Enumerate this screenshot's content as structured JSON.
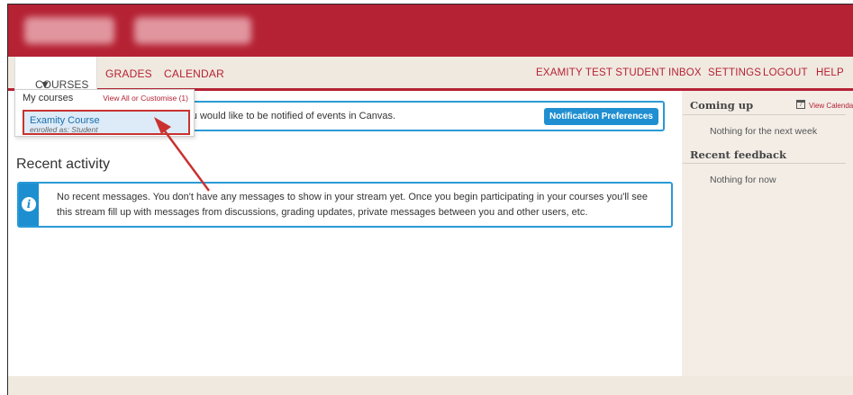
{
  "nav": {
    "courses": "COURSES",
    "grades": "GRADES",
    "calendar": "CALENDAR",
    "user": "EXAMITY TEST STUDENT",
    "inbox": "INBOX",
    "settings": "SETTINGS",
    "logout": "LOGOUT",
    "help": "HELP"
  },
  "dropdown": {
    "my_courses": "My courses",
    "view_all": "View All or Customise (1)",
    "course_name": "Examity Course",
    "course_role": "enrolled as: Student"
  },
  "notice": {
    "text": "n you would like to be notified of events in Canvas.",
    "button": "Notification Preferences"
  },
  "main": {
    "recent_title": "Recent activity",
    "info_text": "No recent messages. You don't have any messages to show in your stream yet. Once you begin participating in your courses you'll see this stream fill up with messages from discussions, grading updates, private messages between you and other users, etc."
  },
  "sidebar": {
    "coming_up": "Coming up",
    "view_calendar": "View Calendar",
    "coming_up_empty": "Nothing for the next week",
    "recent_feedback": "Recent feedback",
    "feedback_empty": "Nothing for now"
  },
  "icons": {
    "info": "info-icon",
    "calendar": "calendar-icon",
    "caret": "chevron-down-icon",
    "annotation_arrow": "arrow-icon"
  },
  "colors": {
    "brand": "#b52234",
    "accent_blue": "#1d8fd1",
    "background": "#f0e9e0"
  }
}
